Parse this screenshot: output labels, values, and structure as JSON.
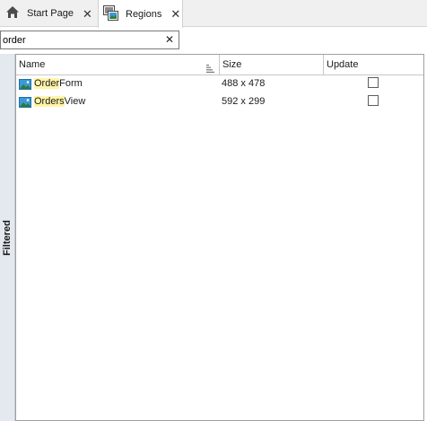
{
  "tabs": [
    {
      "label": "Start Page",
      "icon": "home-icon",
      "close": "✕"
    },
    {
      "label": "Regions",
      "icon": "regions-icon",
      "close": "✕"
    }
  ],
  "search": {
    "value": "order",
    "clear": "✕"
  },
  "side_panel": {
    "label": "Filtered"
  },
  "grid": {
    "columns": [
      "Name",
      "Size",
      "Update"
    ],
    "rows": [
      {
        "match": "Order",
        "rest": "Form",
        "size": "488 x 478",
        "update": false,
        "icon": "image-icon"
      },
      {
        "match": "Orders",
        "rest": "View",
        "size": "592 x 299",
        "update": false,
        "icon": "image-icon"
      }
    ]
  },
  "colors": {
    "highlight": "#fff4a8",
    "side_panel": "#e3e9ef"
  }
}
